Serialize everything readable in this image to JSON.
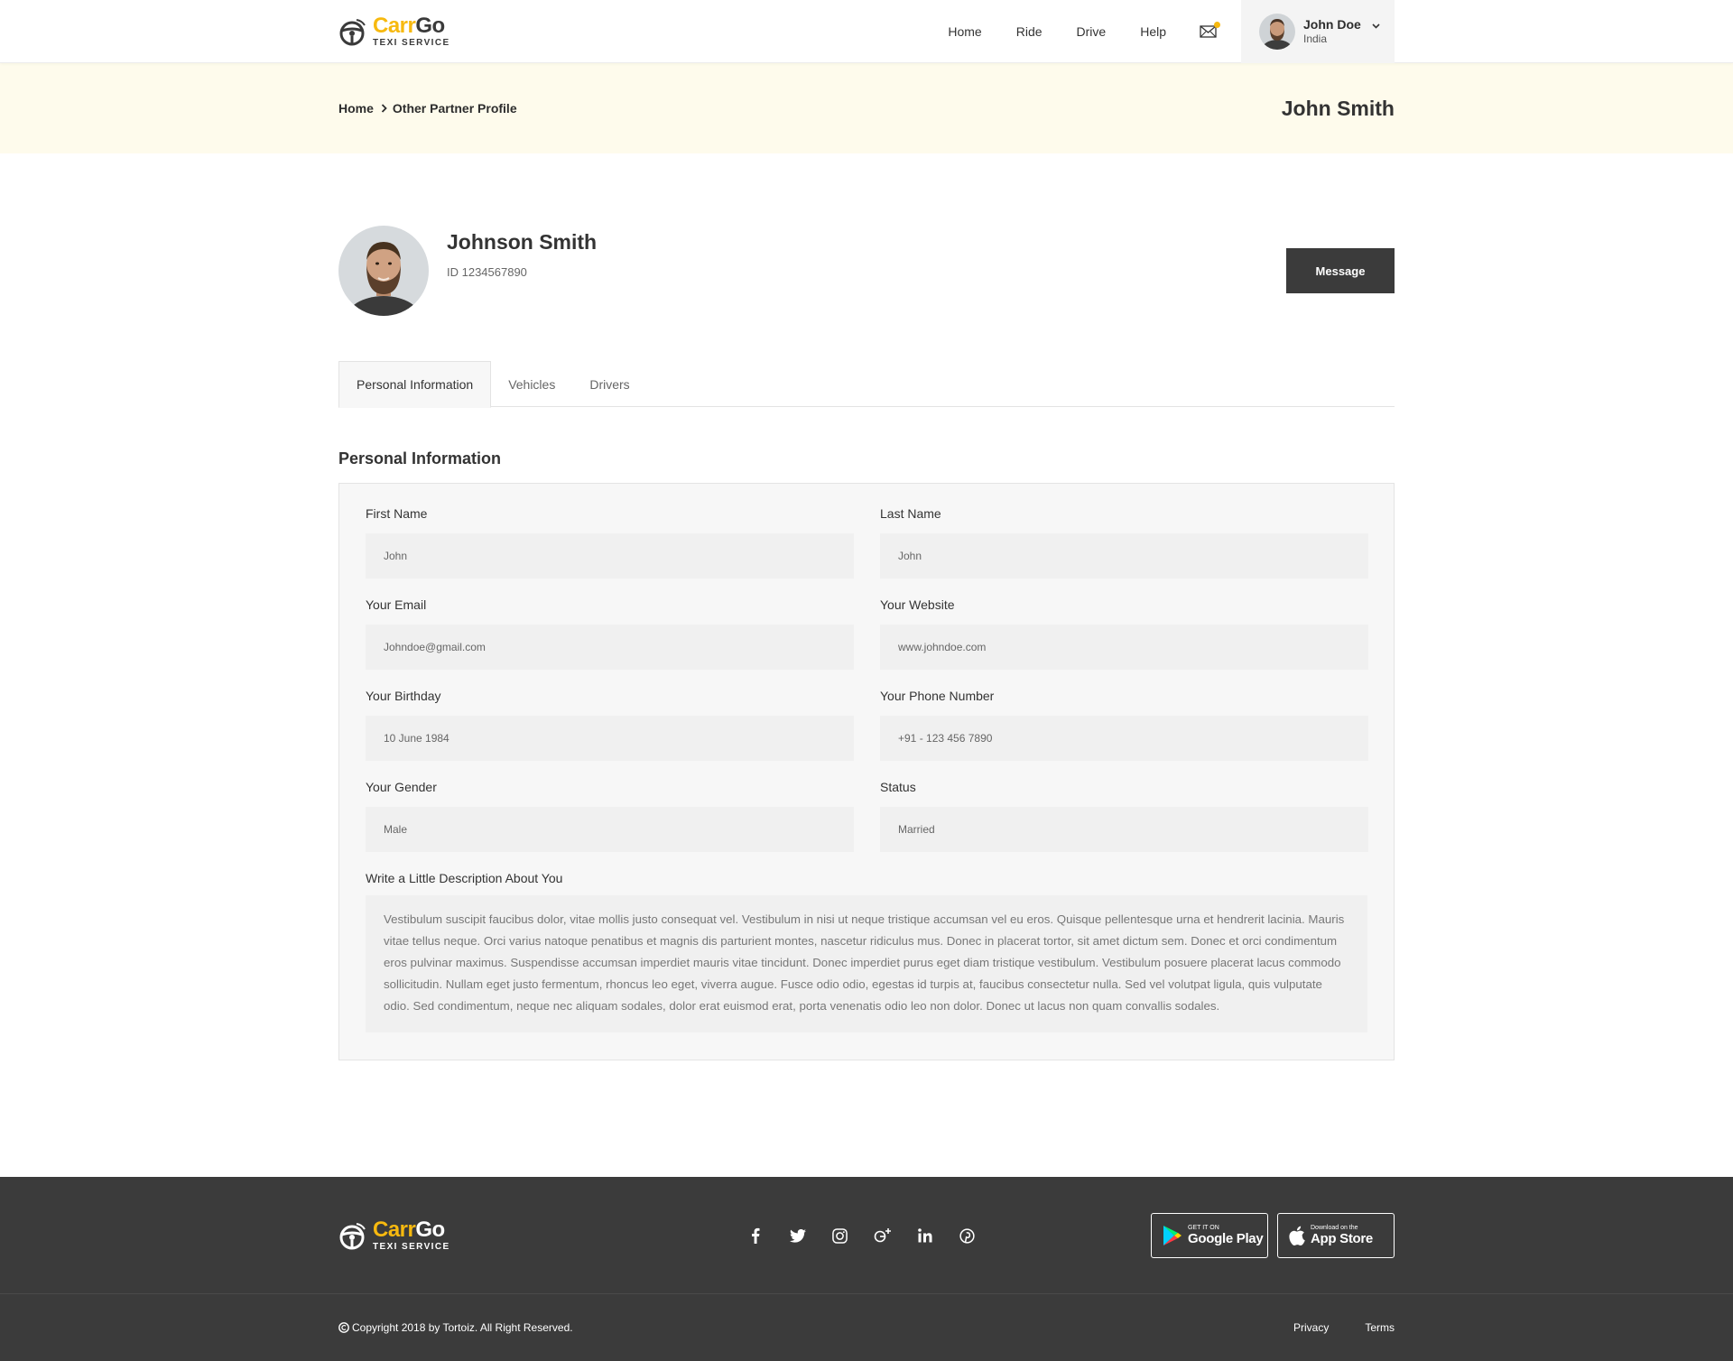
{
  "brand": {
    "name_part1": "Carr",
    "name_part2": "Go",
    "tagline": "TEXI SERVICE",
    "accent": "#f7b90f",
    "dark": "#3b3b3b"
  },
  "header": {
    "nav": [
      "Home",
      "Ride",
      "Drive",
      "Help"
    ],
    "mail_icon": "envelope-icon",
    "user": {
      "name": "John Doe",
      "location": "India"
    }
  },
  "banner": {
    "breadcrumb": [
      "Home",
      "Other Partner Profile"
    ],
    "title": "John Smith"
  },
  "profile": {
    "name": "Johnson Smith",
    "id": "ID 1234567890",
    "message_button": "Message"
  },
  "tabs": [
    "Personal Information",
    "Vehicles",
    "Drivers"
  ],
  "active_tab": "Personal Information",
  "section_title": "Personal Information",
  "form": {
    "fields": [
      {
        "label": "First Name",
        "value": "John"
      },
      {
        "label": "Last Name",
        "value": "John"
      },
      {
        "label": "Your Email",
        "value": "Johndoe@gmail.com"
      },
      {
        "label": "Your Website",
        "value": "www.johndoe.com"
      },
      {
        "label": "Your Birthday",
        "value": "10 June 1984"
      },
      {
        "label": "Your Phone Number",
        "value": "+91 - 123 456 7890"
      },
      {
        "label": "Your Gender",
        "value": "Male"
      },
      {
        "label": "Status",
        "value": "Married"
      }
    ],
    "description_label": "Write a Little Description About You",
    "description": "Vestibulum suscipit faucibus dolor, vitae mollis justo consequat vel. Vestibulum in nisi ut neque tristique accumsan vel eu eros. Quisque pellentesque urna et hendrerit lacinia. Mauris vitae tellus neque. Orci varius natoque penatibus et magnis dis parturient montes, nascetur ridiculus mus. Donec in placerat tortor, sit amet dictum sem. Donec et orci condimentum eros pulvinar maximus. Suspendisse accumsan imperdiet mauris vitae tincidunt. Donec imperdiet purus eget diam tristique vestibulum. Vestibulum posuere placerat lacus commodo sollicitudin. Nullam eget justo fermentum, rhoncus leo eget, viverra augue. Fusce odio odio, egestas id turpis at, faucibus consectetur nulla. Sed vel volutpat ligula, quis vulputate odio. Sed condimentum, neque nec aliquam sodales, dolor erat euismod erat, porta venenatis odio leo non dolor. Donec ut lacus non quam convallis sodales."
  },
  "footer": {
    "socials": [
      "facebook-icon",
      "twitter-icon",
      "instagram-icon",
      "google-plus-icon",
      "linkedin-icon",
      "pinterest-icon"
    ],
    "stores": [
      {
        "small": "GET IT ON",
        "big": "Google Play",
        "icon": "google-play-icon"
      },
      {
        "small": "Download on the",
        "big": "App Store",
        "icon": "apple-icon"
      }
    ],
    "copyright": "Copyright 2018 by Tortoiz. All Right Reserved.",
    "links": [
      "Privacy",
      "Terms"
    ]
  }
}
